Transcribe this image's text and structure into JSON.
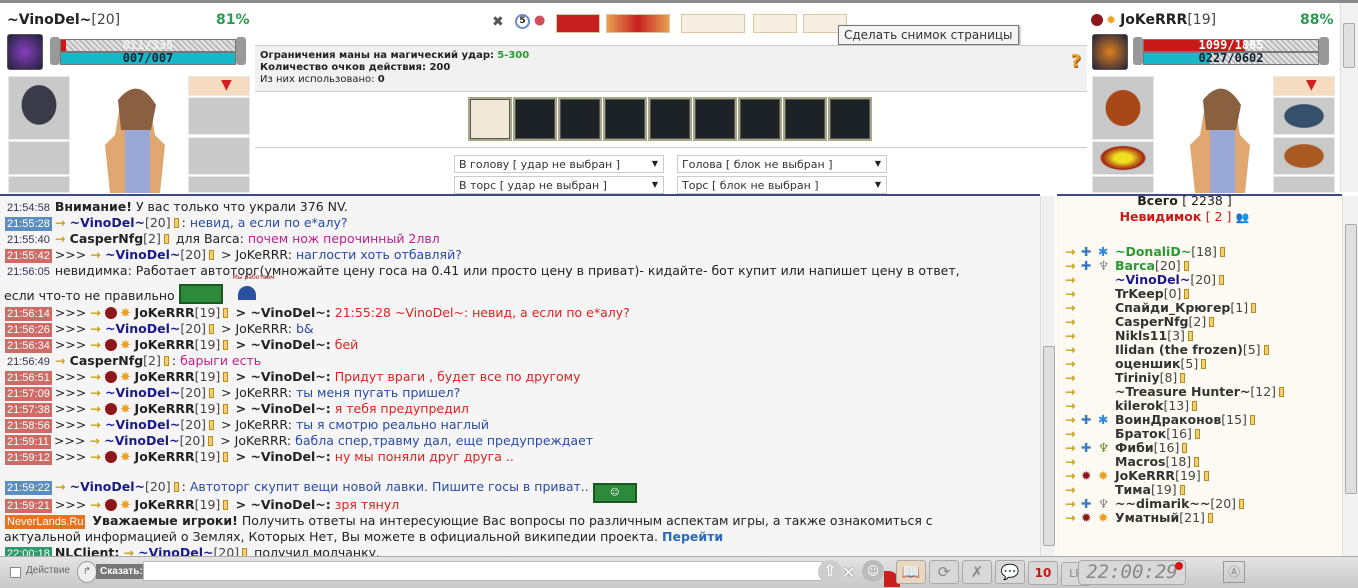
{
  "player_left": {
    "name": "~VinoDel~",
    "level": "[20]",
    "percent": "81%",
    "hp": "011/335",
    "hp_fraction": 0.03,
    "mana": "007/007",
    "mana_fraction": 1.0
  },
  "player_right": {
    "name": "JoKeRRR",
    "level": "[19]",
    "percent": "88%",
    "hp": "1099/1885",
    "hp_fraction": 0.58,
    "mana": "0227/0602",
    "mana_fraction": 0.38
  },
  "tooltip": "Сделать снимок страницы",
  "round_counter": "5",
  "info": {
    "mana_label": "Ограничения маны на магический удар:",
    "mana_value": "5-300",
    "ap_label": "Количество очков действия: 200",
    "used_label": "Из них использовано:",
    "used_value": "0",
    "help": "?"
  },
  "selects": {
    "attack_head": "В голову [ удар не выбран ]",
    "attack_torso": "В торс [ удар не выбран ]",
    "block_head": "Голова [ блок не выбран ]",
    "block_torso": "Торс [ блок не выбран ]"
  },
  "chat": {
    "messages": [
      {
        "type": "system",
        "time": "21:54:58",
        "ts": "plain",
        "bold": "Внимание!",
        "text": "У вас только что украли 376 NV."
      },
      {
        "type": "msg",
        "time": "21:55:28",
        "ts": "blue",
        "pm": false,
        "sender": "~VinoDel~",
        "level": "[20]",
        "scolor": "#1a1a8c",
        "clan": false,
        "sep": ":",
        "text": "невид, а если по е*алу?",
        "tcolor": "#2a4aa8"
      },
      {
        "type": "msg",
        "time": "21:55:40",
        "ts": "plain",
        "pm": false,
        "sender": "CasperNfg",
        "level": "[2]",
        "scolor": "#222",
        "clan": false,
        "sep": " для Barca:",
        "text": "почем нож перочинный 2лвл",
        "tcolor": "#c0208a"
      },
      {
        "type": "msg",
        "time": "21:55:42",
        "ts": "red",
        "pm": true,
        "sender": "~VinoDel~",
        "level": "[20]",
        "scolor": "#1a1a8c",
        "clan": false,
        "sep": " > JoKeRRR:",
        "text": "наглости хоть отбавляй?",
        "tcolor": "#2a4aa8"
      },
      {
        "type": "plain",
        "time": "21:56:05",
        "ts": "plain",
        "text": "невидимка: Работает автоторг(умножайте цену госа на 0.41 или просто цену в приват)- кидайте- бот купит или напишет цену в ответ,",
        "text2": "если что-то не правильно",
        "sign": "Мы работаем"
      },
      {
        "type": "msg",
        "time": "21:56:14",
        "ts": "red",
        "pm": true,
        "sender": "JoKeRRR",
        "level": "[19]",
        "scolor": "#222",
        "clan": true,
        "sep": " > ~VinoDel~:",
        "sepbold": true,
        "text": "21:55:28 ~VinoDel~: невид, а если по е*алу?",
        "tcolor": "#e02020"
      },
      {
        "type": "msg",
        "time": "21:56:26",
        "ts": "red",
        "pm": true,
        "sender": "~VinoDel~",
        "level": "[20]",
        "scolor": "#1a1a8c",
        "clan": false,
        "sep": " > JoKeRRR:",
        "text": "b&",
        "tcolor": "#2a4aa8"
      },
      {
        "type": "msg",
        "time": "21:56:34",
        "ts": "red",
        "pm": true,
        "sender": "JoKeRRR",
        "level": "[19]",
        "scolor": "#222",
        "clan": true,
        "sep": " > ~VinoDel~:",
        "sepbold": true,
        "text": "бей",
        "tcolor": "#e02020"
      },
      {
        "type": "msg",
        "time": "21:56:49",
        "ts": "plain",
        "pm": false,
        "sender": "CasperNfg",
        "level": "[2]",
        "scolor": "#222",
        "clan": false,
        "sep": ":",
        "text": "барыги есть",
        "tcolor": "#c0208a"
      },
      {
        "type": "msg",
        "time": "21:56:51",
        "ts": "red",
        "pm": true,
        "sender": "JoKeRRR",
        "level": "[19]",
        "scolor": "#222",
        "clan": true,
        "sep": " > ~VinoDel~:",
        "sepbold": true,
        "text": "Придут враги , будет все по другому",
        "tcolor": "#e02020"
      },
      {
        "type": "msg",
        "time": "21:57:09",
        "ts": "red",
        "pm": true,
        "sender": "~VinoDel~",
        "level": "[20]",
        "scolor": "#1a1a8c",
        "clan": false,
        "sep": " > JoKeRRR:",
        "text": "ты меня пугать пришел?",
        "tcolor": "#2a4aa8"
      },
      {
        "type": "msg",
        "time": "21:57:38",
        "ts": "red",
        "pm": true,
        "sender": "JoKeRRR",
        "level": "[19]",
        "scolor": "#222",
        "clan": true,
        "sep": " > ~VinoDel~:",
        "sepbold": true,
        "text": "я тебя предупредил",
        "tcolor": "#e02020"
      },
      {
        "type": "msg",
        "time": "21:58:56",
        "ts": "red",
        "pm": true,
        "sender": "~VinoDel~",
        "level": "[20]",
        "scolor": "#1a1a8c",
        "clan": false,
        "sep": " > JoKeRRR:",
        "text": "ты я смотрю реально наглый",
        "tcolor": "#2a4aa8"
      },
      {
        "type": "msg",
        "time": "21:59:11",
        "ts": "red",
        "pm": true,
        "sender": "~VinoDel~",
        "level": "[20]",
        "scolor": "#1a1a8c",
        "clan": false,
        "sep": " > JoKeRRR:",
        "text": "бабла спер,травму дал, еще предупреждает",
        "tcolor": "#2a4aa8"
      },
      {
        "type": "msg",
        "time": "21:59:12",
        "ts": "red",
        "pm": true,
        "sender": "JoKeRRR",
        "level": "[19]",
        "scolor": "#222",
        "clan": true,
        "sep": " > ~VinoDel~:",
        "sepbold": true,
        "text": "ну мы поняли друг друга ..",
        "tcolor": "#e02020"
      },
      {
        "type": "msg",
        "time": "21:59:22",
        "ts": "blue",
        "pm": false,
        "sender": "~VinoDel~",
        "level": "[20]",
        "scolor": "#1a1a8c",
        "clan": false,
        "sep": ":",
        "text": "Автоторг скупит вещи новой лавки. Пишите госы в приват..",
        "tcolor": "#2a4aa8",
        "money": true
      },
      {
        "type": "msg",
        "time": "21:59:21",
        "ts": "red",
        "pm": true,
        "sender": "JoKeRRR",
        "level": "[19]",
        "scolor": "#222",
        "clan": true,
        "sep": " > ~VinoDel~:",
        "sepbold": true,
        "text": "зря тянул",
        "tcolor": "#e02020"
      },
      {
        "type": "news",
        "time": "NeverLands.Ru",
        "ts": "orange",
        "bold": "Уважаемые игроки!",
        "text": "Получить ответы на интересующие Вас вопросы по различным аспектам игры, а также ознакомиться с",
        "text2": "актуальной информацией о Землях, Которых Нет, Вы можете в официальной википедии проекта.",
        "link": "Перейти"
      },
      {
        "type": "nlclient",
        "time": "22:00:18",
        "ts": "green",
        "bold": "NLClient:",
        "sender": "~VinoDel~",
        "level": "[20]",
        "text": "получил молчанку."
      }
    ]
  },
  "users": {
    "total_label": "Всего",
    "total": "[ 2238 ]",
    "invisible_label": "Невидимок",
    "invisible": "[ 2 ]",
    "list": [
      {
        "name": "~DonaliD~",
        "level": "[18]",
        "color": "#2a9a30",
        "clan": "cross",
        "badge": "blue"
      },
      {
        "name": "Barca",
        "level": "[20]",
        "color": "#2a9a30",
        "clan": "cross",
        "badge": "gray"
      },
      {
        "name": "~VinoDel~",
        "level": "[20]",
        "color": "#1a1a8c",
        "clan": "",
        "badge": ""
      },
      {
        "name": "TrKeep",
        "level": "[0]",
        "color": "#333",
        "clan": "",
        "badge": ""
      },
      {
        "name": "Спайди_Крюгер",
        "level": "[1]",
        "color": "#333",
        "clan": "",
        "badge": ""
      },
      {
        "name": "CasperNfg",
        "level": "[2]",
        "color": "#333",
        "clan": "",
        "badge": ""
      },
      {
        "name": "Nikls11",
        "level": "[3]",
        "color": "#333",
        "clan": "",
        "badge": ""
      },
      {
        "name": "Ilidan (the frozen)",
        "level": "[5]",
        "color": "#333",
        "clan": "",
        "badge": ""
      },
      {
        "name": "оценшик",
        "level": "[5]",
        "color": "#333",
        "clan": "",
        "badge": ""
      },
      {
        "name": "Tiriniy",
        "level": "[8]",
        "color": "#333",
        "clan": "",
        "badge": ""
      },
      {
        "name": "~Treasure Hunter~",
        "level": "[12]",
        "color": "#333",
        "clan": "",
        "badge": ""
      },
      {
        "name": "kilerok",
        "level": "[13]",
        "color": "#333",
        "clan": "",
        "badge": ""
      },
      {
        "name": "ВоинДраконов",
        "level": "[15]",
        "color": "#333",
        "clan": "cross",
        "badge": "blue"
      },
      {
        "name": "Браток",
        "level": "[16]",
        "color": "#333",
        "clan": "",
        "badge": ""
      },
      {
        "name": "Фиби",
        "level": "[16]",
        "color": "#333",
        "clan": "cross",
        "badge": "green"
      },
      {
        "name": "Macros",
        "level": "[18]",
        "color": "#333",
        "clan": "",
        "badge": ""
      },
      {
        "name": "JoKeRRR",
        "level": "[19]",
        "color": "#333",
        "clan": "spider",
        "badge": "sun"
      },
      {
        "name": "Тима",
        "level": "[19]",
        "color": "#333",
        "clan": "",
        "badge": ""
      },
      {
        "name": "~~dimarik~~",
        "level": "[20]",
        "color": "#333",
        "clan": "cross",
        "badge": "gray"
      },
      {
        "name": "Уматный",
        "level": "[21]",
        "color": "#333",
        "clan": "spider",
        "badge": "sun"
      }
    ]
  },
  "bottom": {
    "action_label": "Действие",
    "say_label": "Сказать:",
    "input_value": "",
    "clock": "22:00:29",
    "timer": "10"
  }
}
